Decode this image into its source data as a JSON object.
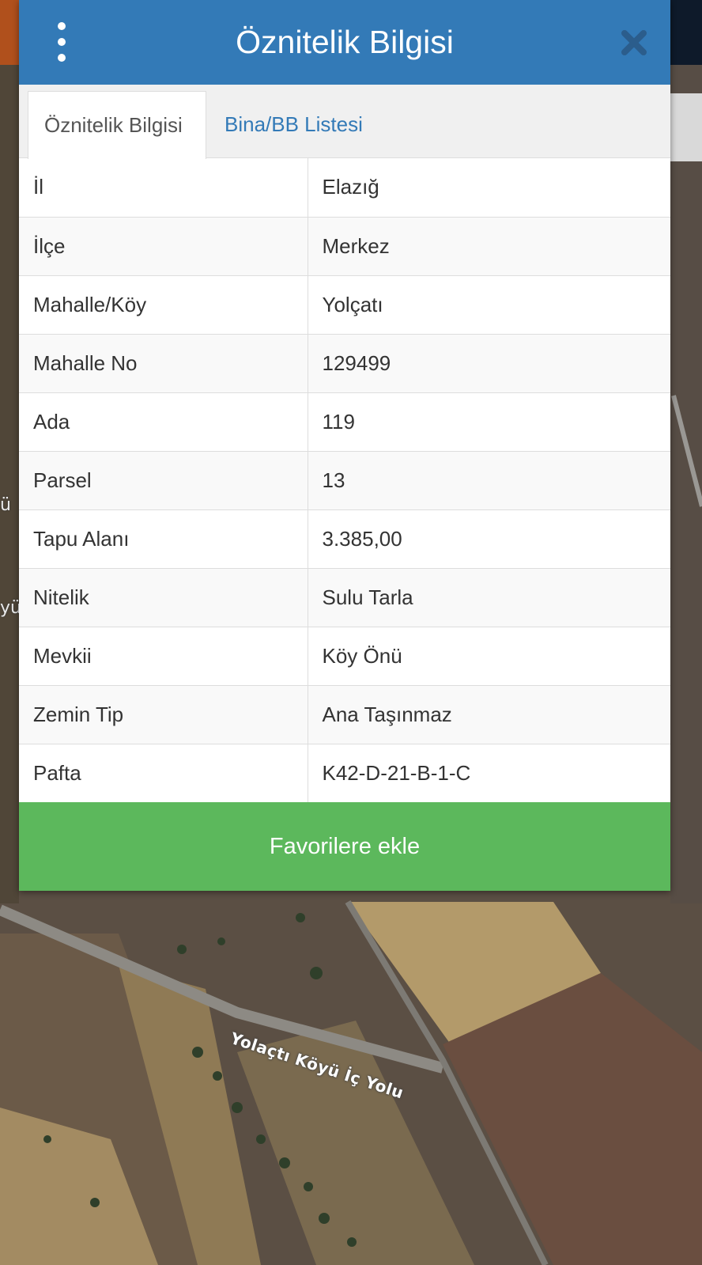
{
  "dialog": {
    "title": "Öznitelik Bilgisi",
    "menu_icon": "vertical-dots-icon",
    "close_icon": "close-icon",
    "header_color": "#337ab7"
  },
  "tabs": [
    {
      "label": "Öznitelik Bilgisi",
      "active": true
    },
    {
      "label": "Bina/BB Listesi",
      "active": false
    }
  ],
  "attributes": [
    {
      "key": "İl",
      "value": "Elazığ"
    },
    {
      "key": "İlçe",
      "value": "Merkez"
    },
    {
      "key": "Mahalle/Köy",
      "value": "Yolçatı"
    },
    {
      "key": "Mahalle No",
      "value": "129499"
    },
    {
      "key": "Ada",
      "value": "119"
    },
    {
      "key": "Parsel",
      "value": "13"
    },
    {
      "key": "Tapu Alanı",
      "value": "3.385,00"
    },
    {
      "key": "Nitelik",
      "value": "Sulu Tarla"
    },
    {
      "key": "Mevkii",
      "value": "Köy Önü"
    },
    {
      "key": "Zemin Tip",
      "value": "Ana Taşınmaz"
    },
    {
      "key": "Pafta",
      "value": "K42-D-21-B-1-C"
    }
  ],
  "actions": {
    "favorite_label": "Favorilere ekle",
    "favorite_color": "#5cb85c"
  },
  "map": {
    "road_label": "Yolaçtı Köyü İç Yolu",
    "edge_label_1": "ü",
    "edge_label_2": "yü"
  }
}
